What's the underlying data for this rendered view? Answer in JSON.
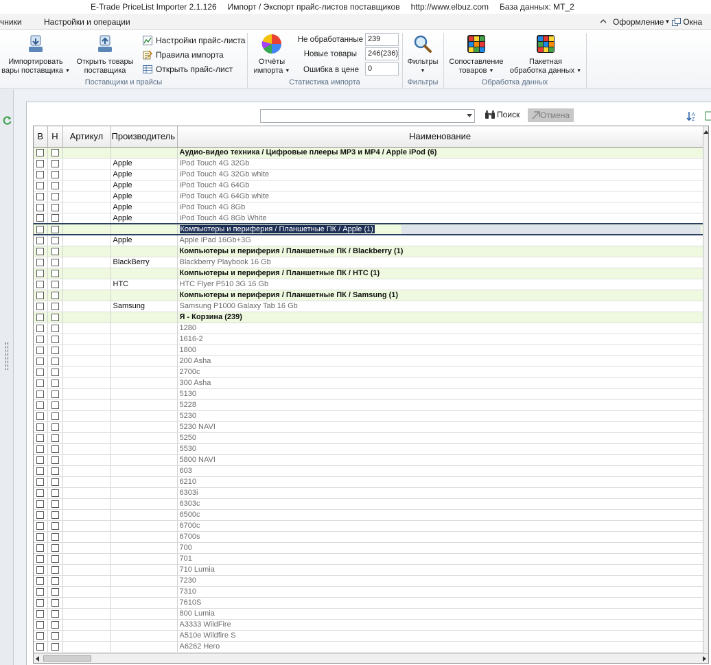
{
  "titlebar": {
    "app": "E-Trade PriceList Importer 2.1.126",
    "subtitle": "Импорт / Экспорт прайс-листов поставщиков",
    "url": "http://www.elbuz.com",
    "database": "База данных: MT_2"
  },
  "menubar": {
    "items": [
      "чники",
      "Настройки и операции"
    ],
    "appearance": "Оформление",
    "windows": "Окна"
  },
  "ribbon": {
    "suppliers": {
      "import_line1": "Импортировать",
      "import_line2": "вары поставщика",
      "open_line1": "Открыть товары",
      "open_line2": "поставщика",
      "caption": "Поставщики и прайсы"
    },
    "pricelist": {
      "settings": "Настройки прайс-листа",
      "rules": "Правила импорта",
      "open": "Открыть прайс-лист"
    },
    "stats": {
      "reports_line1": "Отчёты",
      "reports_line2": "импорта",
      "unprocessed_label": "Не обработанные",
      "unprocessed_value": "239",
      "new_label": "Новые товары",
      "new_value": "246(236)",
      "price_error_label": "Ошибка в цене",
      "price_error_value": "0",
      "caption": "Статистика импорта"
    },
    "filters": {
      "label": "Фильтры",
      "caption": "Фильтры"
    },
    "processing": {
      "match_line1": "Сопоставление",
      "match_line2": "товаров",
      "batch_line1": "Пакетная",
      "batch_line2": "обработка данных",
      "caption": "Обработка данных"
    }
  },
  "search": {
    "value": "",
    "search_label": "Поиск",
    "cancel_label": "Отмена"
  },
  "table": {
    "columns": [
      "В",
      "Н",
      "Артикул",
      "Производитель",
      "Наименование"
    ],
    "rows": [
      {
        "type": "group",
        "maker": "",
        "name": "Аудио-видео техника / Цифровые плееры MP3 и MP4 / Apple iPod (6)"
      },
      {
        "type": "item",
        "maker": "Apple",
        "name": "iPod  Touch 4G 32Gb"
      },
      {
        "type": "item",
        "maker": "Apple",
        "name": "iPod  Touch 4G 32Gb white"
      },
      {
        "type": "item",
        "maker": "Apple",
        "name": "iPod  Touch 4G 64Gb"
      },
      {
        "type": "item",
        "maker": "Apple",
        "name": "iPod  Touch 4G 64Gb white"
      },
      {
        "type": "item",
        "maker": "Apple",
        "name": "iPod  Touch 4G 8Gb"
      },
      {
        "type": "item",
        "maker": "Apple",
        "name": "iPod  Touch 4G 8Gb White"
      },
      {
        "type": "selected",
        "maker": "",
        "name": "Компьютеры и периферия / Планшетные ПК / Apple (1)"
      },
      {
        "type": "item",
        "maker": "Apple",
        "name": "Apple iPad 16Gb+3G"
      },
      {
        "type": "group",
        "maker": "",
        "name": "Компьютеры и периферия / Планшетные ПК / Blackberry (1)"
      },
      {
        "type": "item",
        "maker": "BlackBerry",
        "name": "Blackberry Playbook 16 Gb"
      },
      {
        "type": "group",
        "maker": "",
        "name": "Компьютеры и периферия / Планшетные ПК / HTC (1)"
      },
      {
        "type": "item",
        "maker": "HTC",
        "name": "HTC Flyer P510 3G 16 Gb"
      },
      {
        "type": "group",
        "maker": "",
        "name": "Компьютеры и периферия / Планшетные ПК / Samsung (1)"
      },
      {
        "type": "item",
        "maker": "Samsung",
        "name": "Samsung P1000 Galaxy Tab 16 Gb"
      },
      {
        "type": "group",
        "maker": "",
        "name": "Я - Корзина (239)"
      },
      {
        "type": "item",
        "maker": "",
        "name": "1280"
      },
      {
        "type": "item",
        "maker": "",
        "name": "1616-2"
      },
      {
        "type": "item",
        "maker": "",
        "name": "1800"
      },
      {
        "type": "item",
        "maker": "",
        "name": "200 Asha"
      },
      {
        "type": "item",
        "maker": "",
        "name": "2700c"
      },
      {
        "type": "item",
        "maker": "",
        "name": "300 Asha"
      },
      {
        "type": "item",
        "maker": "",
        "name": "5130"
      },
      {
        "type": "item",
        "maker": "",
        "name": "5228"
      },
      {
        "type": "item",
        "maker": "",
        "name": "5230"
      },
      {
        "type": "item",
        "maker": "",
        "name": "5230 NAVI"
      },
      {
        "type": "item",
        "maker": "",
        "name": "5250"
      },
      {
        "type": "item",
        "maker": "",
        "name": "5530"
      },
      {
        "type": "item",
        "maker": "",
        "name": "5800 NAVI"
      },
      {
        "type": "item",
        "maker": "",
        "name": "603"
      },
      {
        "type": "item",
        "maker": "",
        "name": "6210"
      },
      {
        "type": "item",
        "maker": "",
        "name": "6303i"
      },
      {
        "type": "item",
        "maker": "",
        "name": "6303c"
      },
      {
        "type": "item",
        "maker": "",
        "name": "6500c"
      },
      {
        "type": "item",
        "maker": "",
        "name": "6700c"
      },
      {
        "type": "item",
        "maker": "",
        "name": "6700s"
      },
      {
        "type": "item",
        "maker": "",
        "name": "700"
      },
      {
        "type": "item",
        "maker": "",
        "name": "701"
      },
      {
        "type": "item",
        "maker": "",
        "name": "710 Lumia"
      },
      {
        "type": "item",
        "maker": "",
        "name": "7230"
      },
      {
        "type": "item",
        "maker": "",
        "name": "7310"
      },
      {
        "type": "item",
        "maker": "",
        "name": "7610S"
      },
      {
        "type": "item",
        "maker": "",
        "name": "800 Lumia"
      },
      {
        "type": "item",
        "maker": "",
        "name": "A3333 WildFire"
      },
      {
        "type": "item",
        "maker": "",
        "name": "A510e Wildfire S"
      },
      {
        "type": "item",
        "maker": "",
        "name": "A6262 Hero"
      }
    ]
  }
}
